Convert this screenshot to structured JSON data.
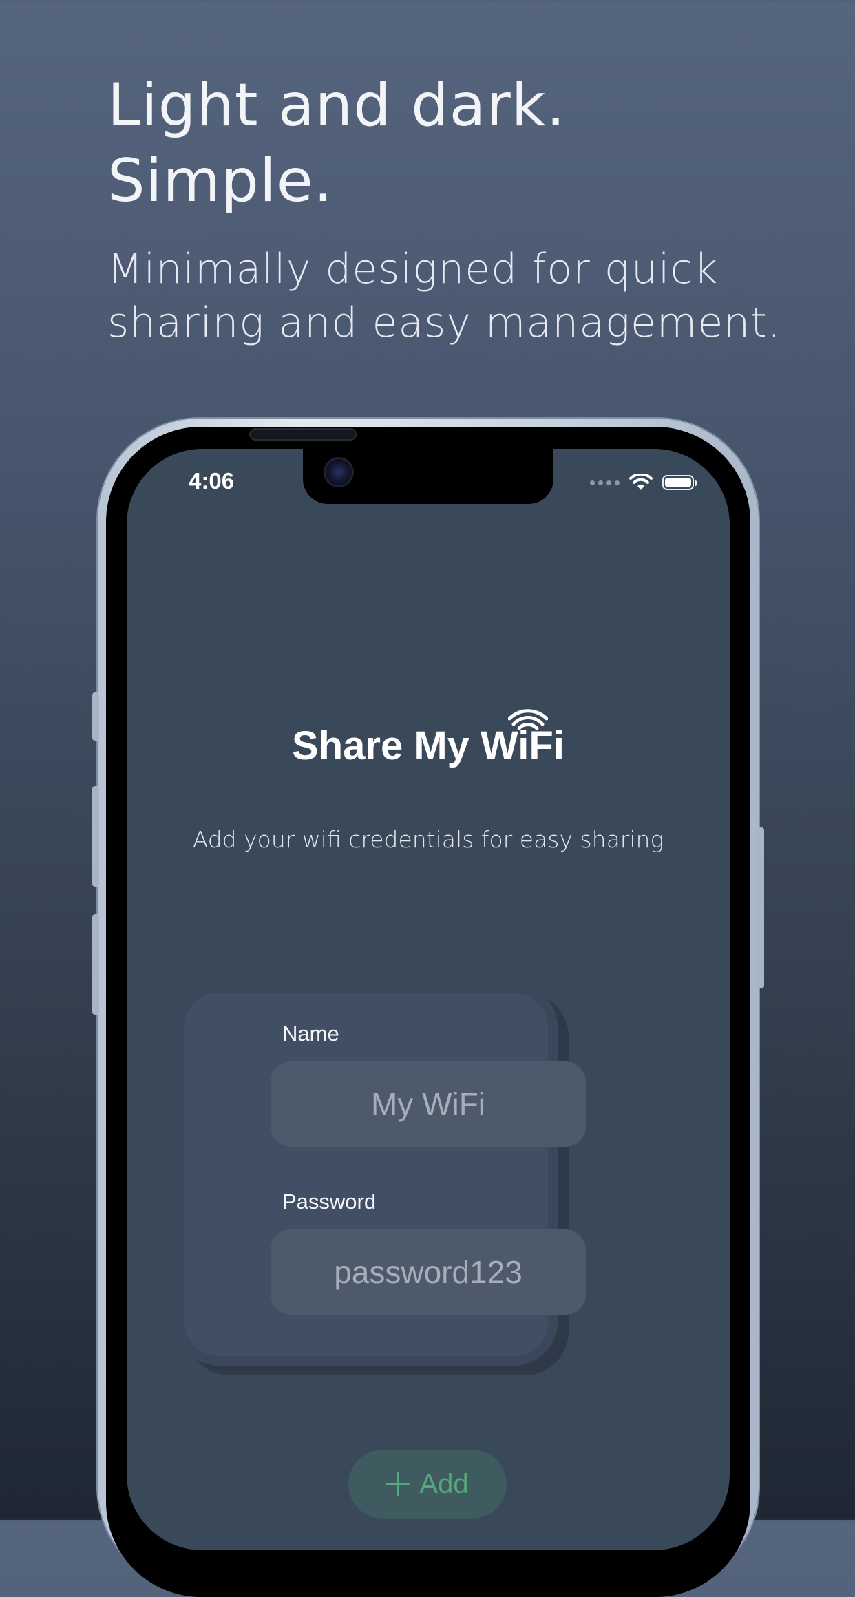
{
  "promo": {
    "headline_line1": "Light and dark.",
    "headline_line2": "Simple.",
    "subhead_line1": "Minimally designed for quick",
    "subhead_line2": "sharing and easy management."
  },
  "status_bar": {
    "time": "4:06",
    "icons": [
      "signal-dots-icon",
      "wifi-icon",
      "battery-icon"
    ]
  },
  "app": {
    "title": "Share My WiFi",
    "subtitle": "Add your wifi credentials for easy sharing",
    "form": {
      "name_label": "Name",
      "name_placeholder": "My WiFi",
      "password_label": "Password",
      "password_placeholder": "password123"
    },
    "add_button_label": "Add"
  },
  "colors": {
    "screen_background": "#3a495a",
    "card_background": "#414f64",
    "accent_green": "#53a97a"
  }
}
